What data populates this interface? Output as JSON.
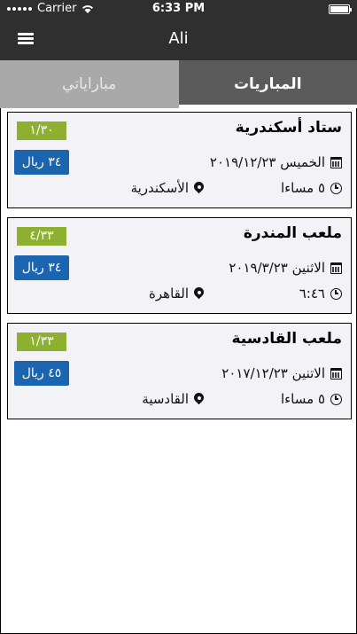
{
  "status_bar": {
    "carrier": "Carrier",
    "time": "6:33 PM",
    "battery_level": 1.0
  },
  "nav": {
    "title": "Ali",
    "menu_icon": "hamburger-menu-icon"
  },
  "tabs": [
    {
      "label": "مباراياتي",
      "active": false
    },
    {
      "label": "المباريات",
      "active": true
    }
  ],
  "matches": [
    {
      "venue": "ستاد أسكندرية",
      "seats": "١/٣٠",
      "price": "٣٤ ريال",
      "date": "الخميس ٢٠١٩/١٢/٢٣",
      "time": "٥ مساءا",
      "location": "الأسكندرية"
    },
    {
      "venue": "ملعب المندرة",
      "seats": "٤/٣٣",
      "price": "٣٤ ريال",
      "date": "الاثنين ٢٠١٩/٣/٢٣",
      "time": "٦:٤٦",
      "location": "القاهرة"
    },
    {
      "venue": "ملعب القادسية",
      "seats": "١/٣٣",
      "price": "٤٥ ريال",
      "date": "الاتنين ٢٠١٧/١٢/٢٣",
      "time": "٥ مساءا",
      "location": "القادسية"
    }
  ],
  "colors": {
    "bar": "#2f2f2f",
    "tab_active": "#5b5b5b",
    "tab_inactive": "#a9a9a9",
    "seats_badge": "#8db031",
    "price_badge": "#1b65b0",
    "card_bg": "#f3f3f7"
  }
}
